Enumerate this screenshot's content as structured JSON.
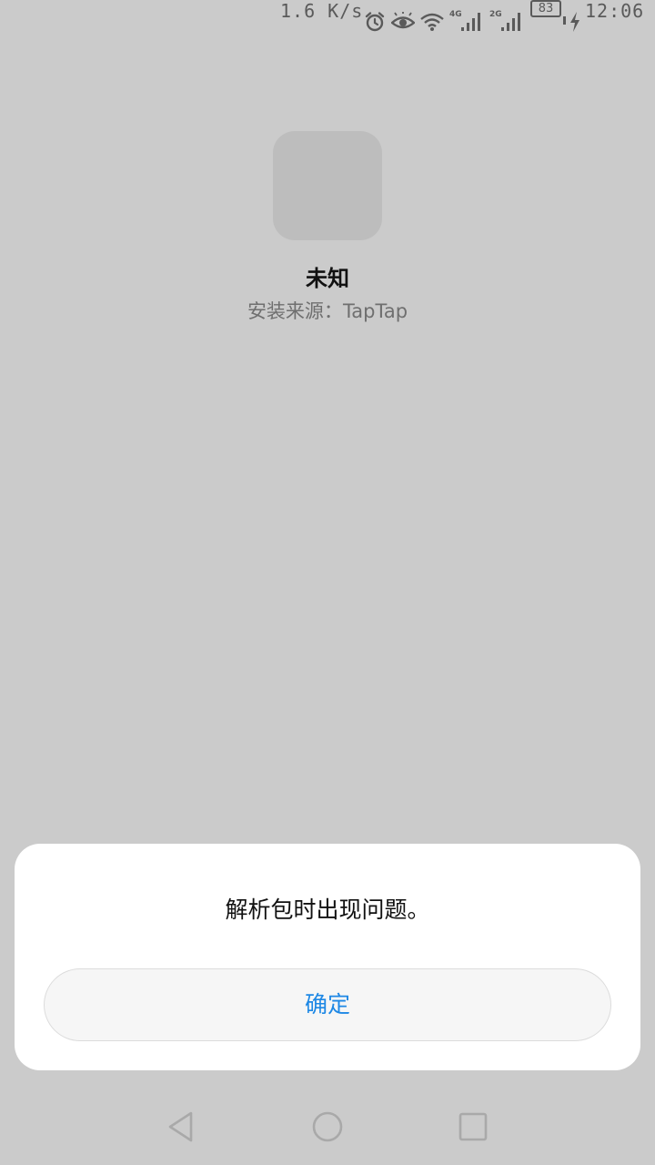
{
  "status_bar": {
    "net_speed": "1.6 K/s",
    "network_1": "4G",
    "network_2": "2G",
    "battery_level": "83",
    "time": "12:06",
    "icons": [
      "alarm-icon",
      "eye-comfort-icon",
      "wifi-icon",
      "signal-4g-icon",
      "signal-2g-icon",
      "battery-icon",
      "charging-icon"
    ]
  },
  "app": {
    "name": "未知",
    "source_label": "安装来源：",
    "source_value": "TapTap"
  },
  "dialog": {
    "message": "解析包时出现问题。",
    "confirm_label": "确定"
  },
  "nav_bar": {
    "icons": [
      "back-icon",
      "home-icon",
      "recents-icon"
    ]
  },
  "colors": {
    "background": "#cbcbcb",
    "dialog_background": "#ffffff",
    "accent": "#1e88e5",
    "status_text": "#5a5a5a"
  }
}
